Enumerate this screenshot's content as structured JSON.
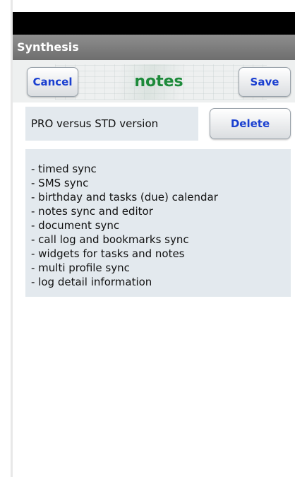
{
  "app": {
    "title": "Synthesis"
  },
  "header": {
    "cancel_label": "Cancel",
    "title": "notes",
    "save_label": "Save"
  },
  "note": {
    "subject": "PRO versus STD version",
    "delete_label": "Delete",
    "lines": [
      "- timed sync",
      "- SMS sync",
      "- birthday and tasks (due) calendar",
      "- notes sync and editor",
      "- document sync",
      "- call log and bookmarks sync",
      "- widgets for tasks and notes",
      "- multi profile sync",
      "- log detail information"
    ]
  },
  "colors": {
    "accent_button_text": "#1a3fd0",
    "header_title": "#1d8a3a",
    "field_background": "#e3e9ee"
  }
}
